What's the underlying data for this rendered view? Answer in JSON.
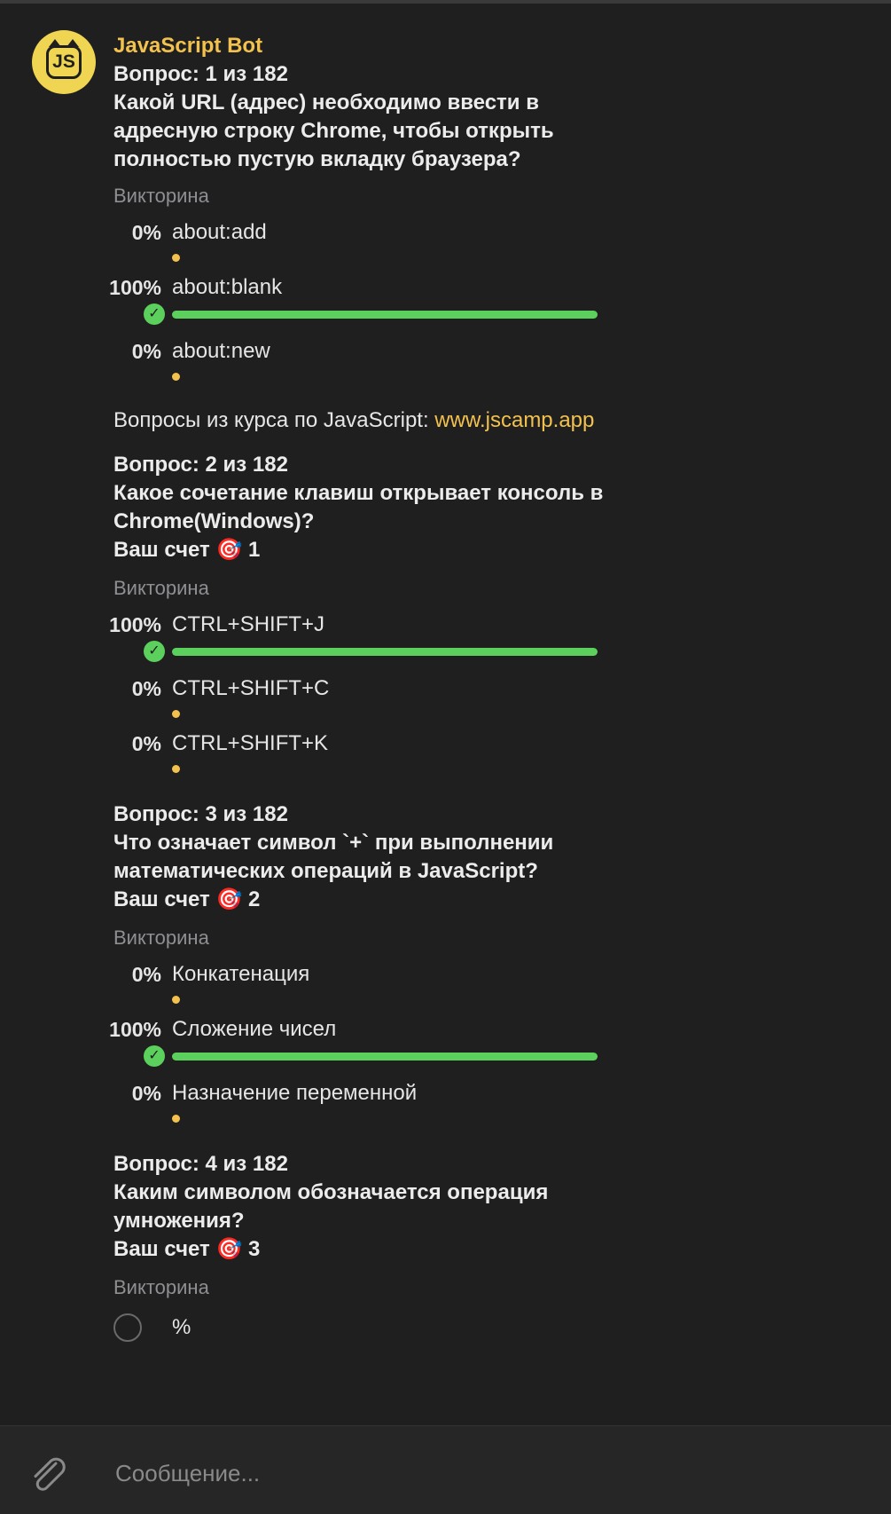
{
  "bot": {
    "name": "JavaScript Bot",
    "avatar_text": "JS"
  },
  "quiz_label": "Викторина",
  "score_label": "Ваш счет",
  "score_icon": "dart-target-icon",
  "questions": [
    {
      "header": "Вопрос: 1 из 182",
      "text_lines": [
        "Какой URL (адрес) необходимо ввести в",
        "адресную строку Chrome, чтобы открыть",
        "полностью пустую вкладку браузера?"
      ],
      "options": [
        {
          "percent": "0%",
          "text": "about:add",
          "fraction": 0,
          "correct": false
        },
        {
          "percent": "100%",
          "text": "about:blank",
          "fraction": 1,
          "correct": true
        },
        {
          "percent": "0%",
          "text": "about:new",
          "fraction": 0,
          "correct": false
        }
      ]
    },
    {
      "header": "Вопрос: 2 из 182",
      "text_lines": [
        "Какое сочетание клавиш открывает консоль в",
        "Chrome(Windows)?"
      ],
      "score": "1",
      "options": [
        {
          "percent": "100%",
          "text": "CTRL+SHIFT+J",
          "fraction": 1,
          "correct": true
        },
        {
          "percent": "0%",
          "text": "CTRL+SHIFT+C",
          "fraction": 0,
          "correct": false
        },
        {
          "percent": "0%",
          "text": "CTRL+SHIFT+K",
          "fraction": 0,
          "correct": false
        }
      ]
    },
    {
      "header": "Вопрос: 3 из 182",
      "text_lines": [
        "Что означает символ `+` при выполнении",
        "математических операций в JavaScript?"
      ],
      "score": "2",
      "options": [
        {
          "percent": "0%",
          "text": "Конкатенация",
          "fraction": 0,
          "correct": false
        },
        {
          "percent": "100%",
          "text": "Сложение чисел",
          "fraction": 1,
          "correct": true
        },
        {
          "percent": "0%",
          "text": "Назначение переменной",
          "fraction": 0,
          "correct": false
        }
      ]
    },
    {
      "header": "Вопрос: 4 из 182",
      "text_lines": [
        "Каким символом обозначается операция",
        "умножения?"
      ],
      "score": "3",
      "options": [
        {
          "text": "%"
        }
      ]
    }
  ],
  "course_promo": {
    "text": "Вопросы из курса по JavaScript: ",
    "link": "www.jscamp.app"
  },
  "composer": {
    "placeholder": "Сообщение...",
    "attach_icon": "paperclip-icon"
  },
  "colors": {
    "accent": "#f2c14e",
    "correct": "#5cd05c",
    "background": "#1f1f1f"
  }
}
